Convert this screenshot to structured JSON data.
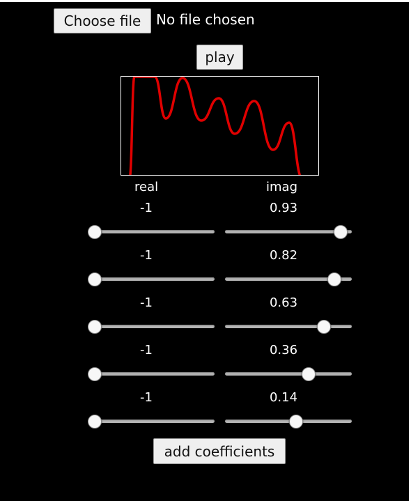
{
  "file_input": {
    "button_label": "Choose file",
    "status_text": "No file chosen"
  },
  "play_button": {
    "label": "play"
  },
  "headers": {
    "real": "real",
    "imag": "imag"
  },
  "slider_range": {
    "min": -1,
    "max": 1
  },
  "coefficients": [
    {
      "real": -1,
      "real_label": "-1",
      "imag": 0.93,
      "imag_label": "0.93"
    },
    {
      "real": -1,
      "real_label": "-1",
      "imag": 0.82,
      "imag_label": "0.82"
    },
    {
      "real": -1,
      "real_label": "-1",
      "imag": 0.63,
      "imag_label": "0.63"
    },
    {
      "real": -1,
      "real_label": "-1",
      "imag": 0.36,
      "imag_label": "0.36"
    },
    {
      "real": -1,
      "real_label": "-1",
      "imag": 0.14,
      "imag_label": "0.14"
    }
  ],
  "add_button": {
    "label": "add coefficients"
  },
  "colors": {
    "background": "#000000",
    "waveform": "#e00000",
    "plot_border": "#ffffff",
    "text": "#ffffff"
  }
}
